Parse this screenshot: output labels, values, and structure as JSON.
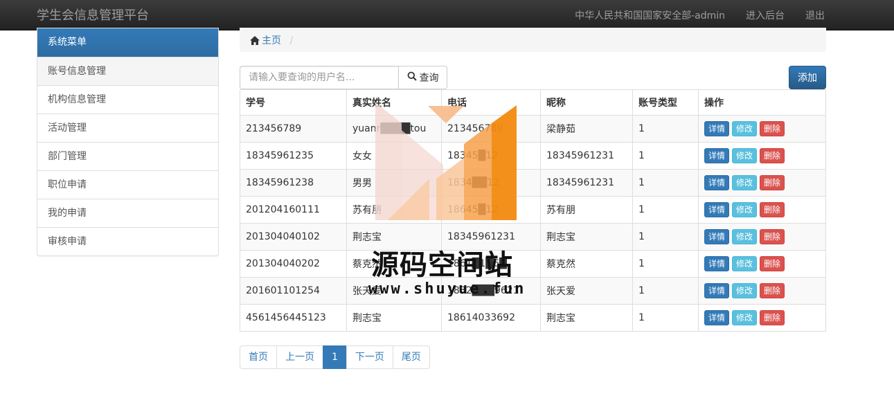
{
  "navbar": {
    "brand": "学生会信息管理平台",
    "user": "中华人民共和国国家安全部-admin",
    "admin_link": "进入后台",
    "logout": "退出"
  },
  "sidebar": {
    "header": "系统菜单",
    "items": [
      {
        "label": "账号信息管理"
      },
      {
        "label": "机构信息管理"
      },
      {
        "label": "活动管理"
      },
      {
        "label": "部门管理"
      },
      {
        "label": "职位申请"
      },
      {
        "label": "我的申请"
      },
      {
        "label": "审核申请"
      }
    ]
  },
  "breadcrumb": {
    "home": "主页",
    "sep": "/"
  },
  "search": {
    "placeholder": "请输入要查询的用户名...",
    "button": "查询"
  },
  "add_button": "添加",
  "table": {
    "headers": [
      "学号",
      "真实姓名",
      "电话",
      "昵称",
      "账号类型",
      "操作"
    ],
    "rows": [
      {
        "id": "213456789",
        "name": "yuanr████tou",
        "phone": "213456789",
        "nick": "梁静茹",
        "type": "1"
      },
      {
        "id": "18345961235",
        "name": "女女",
        "phone": "18345█12",
        "nick": "18345961231",
        "type": "1"
      },
      {
        "id": "18345961238",
        "name": "男男",
        "phone": "1834██12",
        "nick": "18345961231",
        "type": "1"
      },
      {
        "id": "201204160111",
        "name": "苏有朋",
        "phone": "18645█12",
        "nick": "苏有朋",
        "type": "1"
      },
      {
        "id": "201304040102",
        "name": "荆志宝",
        "phone": "18345961231",
        "nick": "荆志宝",
        "type": "1"
      },
      {
        "id": "201304040202",
        "name": "蔡克然",
        "phone": "1861█1█6█",
        "nick": "蔡克然",
        "type": "1"
      },
      {
        "id": "201601101254",
        "name": "张天爱",
        "phone": "1832███9621",
        "nick": "张天爱",
        "type": "1"
      },
      {
        "id": "4561456445123",
        "name": "荆志宝",
        "phone": "18614033692",
        "nick": "荆志宝",
        "type": "1"
      }
    ],
    "actions": {
      "detail": "详情",
      "edit": "修改",
      "delete": "删除"
    }
  },
  "pagination": {
    "first": "首页",
    "prev": "上一页",
    "current": "1",
    "next": "下一页",
    "last": "尾页"
  },
  "watermark": {
    "title": "源码空间站",
    "url": "www.shuyue.fun"
  },
  "colors": {
    "primary": "#337ab7",
    "info": "#5bc0de",
    "danger": "#d9534f",
    "navbar": "#222222"
  }
}
